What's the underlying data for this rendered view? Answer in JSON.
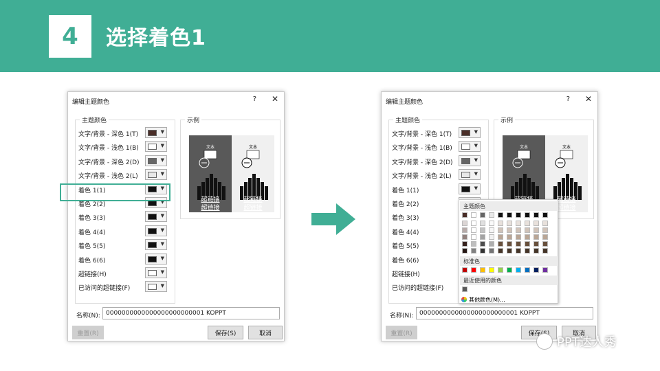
{
  "slide": {
    "number": "4",
    "title": "选择着色1"
  },
  "dialog": {
    "title": "编辑主题颜色",
    "help": "?",
    "close": "✕",
    "theme_group_title": "主题颜色",
    "sample_group_title": "示例",
    "rows": [
      {
        "label": "文字/背景 - 深色 1(T)",
        "color": "#4a2e28"
      },
      {
        "label": "文字/背景 - 浅色 1(B)",
        "color": "#ffffff"
      },
      {
        "label": "文字/背景 - 深色 2(D)",
        "color": "#666666"
      },
      {
        "label": "文字/背景 - 浅色 2(L)",
        "color": "#e8e8e8"
      },
      {
        "label": "着色 1(1)",
        "color": "#111111"
      },
      {
        "label": "着色 2(2)",
        "color": "#111111"
      },
      {
        "label": "着色 3(3)",
        "color": "#111111"
      },
      {
        "label": "着色 4(4)",
        "color": "#111111"
      },
      {
        "label": "着色 5(5)",
        "color": "#111111"
      },
      {
        "label": "着色 6(6)",
        "color": "#111111"
      },
      {
        "label": "超链接(H)",
        "color": "#ffffff"
      },
      {
        "label": "已访问的超链接(F)",
        "color": "#ffffff"
      }
    ],
    "preview": {
      "text": "文本",
      "link": "超链接",
      "visited": "超链接"
    },
    "name_label": "名称(N):",
    "name_value": "0000000000000000000000001 KOPPT",
    "reset_label": "重置(R)",
    "save_label": "保存(S)",
    "cancel_label": "取消"
  },
  "palette": {
    "theme_header": "主题颜色",
    "standard_header": "标准色",
    "recent_header": "最近使用的颜色",
    "more_label": "其他颜色(M)...",
    "top_row": [
      "#4a2e28",
      "#ffffff",
      "#666666",
      "#e8e8e8",
      "#111111",
      "#111111",
      "#111111",
      "#111111",
      "#111111",
      "#111111"
    ],
    "standard": [
      "#c00000",
      "#ff0000",
      "#ffc000",
      "#ffff00",
      "#92d050",
      "#00b050",
      "#00b0f0",
      "#0070c0",
      "#002060",
      "#7030a0"
    ],
    "recent": [
      "#595959"
    ]
  },
  "watermark": "PPT达人秀",
  "colors": {
    "accent": "#40ae95"
  }
}
